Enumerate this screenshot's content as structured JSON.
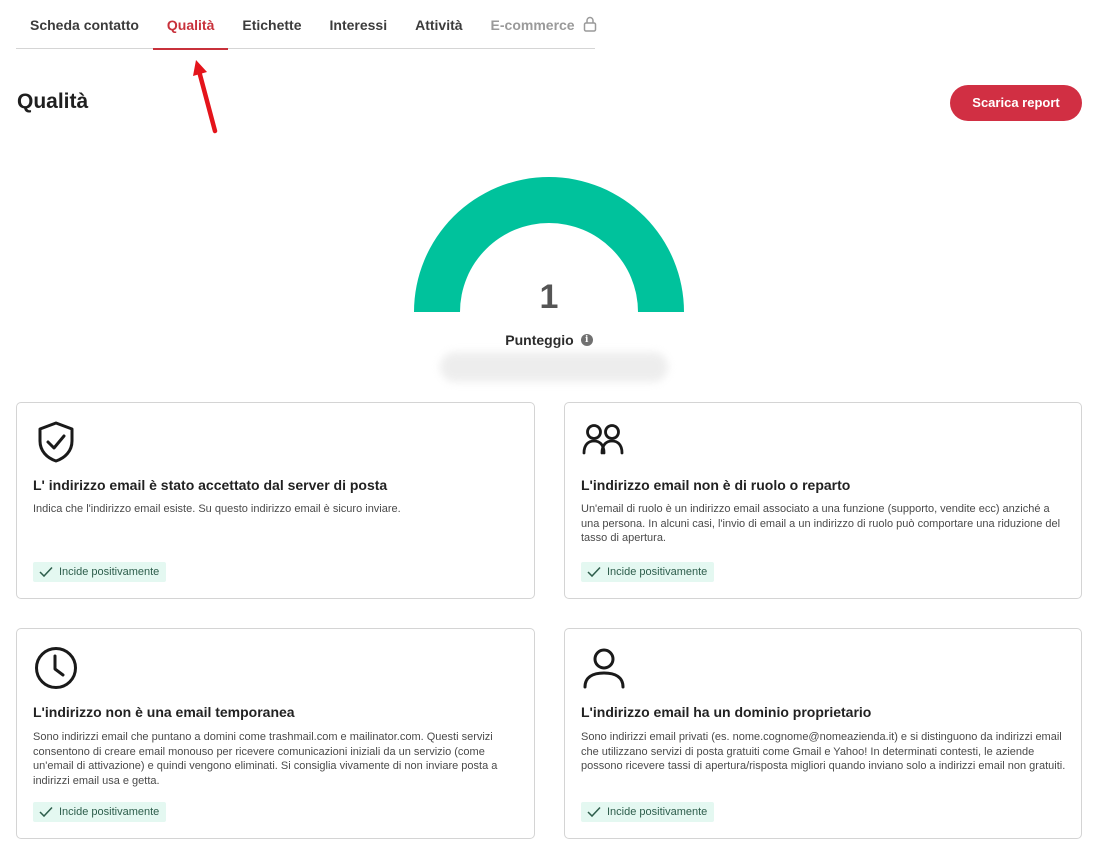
{
  "tabs": [
    {
      "label": "Scheda contatto"
    },
    {
      "label": "Qualità"
    },
    {
      "label": "Etichette"
    },
    {
      "label": "Interessi"
    },
    {
      "label": "Attività"
    },
    {
      "label": "E-commerce"
    }
  ],
  "header": {
    "title": "Qualità",
    "report_button": "Scarica report"
  },
  "gauge": {
    "value": "1",
    "label": "Punteggio",
    "color": "#00c29c"
  },
  "cards": [
    {
      "title": "L' indirizzo email è stato accettato dal server di posta",
      "text": "Indica che l'indirizzo email esiste. Su questo indirizzo email è sicuro inviare.",
      "badge": "Incide positivamente",
      "icon": "shield-check-icon"
    },
    {
      "title": "L'indirizzo email non è di ruolo o reparto",
      "text": "Un'email di ruolo è un indirizzo email associato a una funzione (supporto, vendite ecc) anziché a una persona. In alcuni casi, l'invio di email a un indirizzo di ruolo può comportare una riduzione del tasso di apertura.",
      "badge": "Incide positivamente",
      "icon": "users-icon"
    },
    {
      "title": "L'indirizzo non è una email temporanea",
      "text": "Sono indirizzi email che puntano a domini come trashmail.com e mailinator.com. Questi servizi consentono di creare email monouso per ricevere comunicazioni iniziali da un servizio (come un'email di attivazione) e quindi vengono eliminati. Si consiglia vivamente di non inviare posta a indirizzi email usa e getta.",
      "badge": "Incide positivamente",
      "icon": "clock-icon"
    },
    {
      "title": "L'indirizzo email ha un dominio proprietario",
      "text": "Sono indirizzi email privati (es. nome.cognome@nomeazienda.it) e si distinguono da indirizzi email che utilizzano servizi di posta gratuiti come Gmail e Yahoo! In determinati contesti, le aziende possono ricevere tassi di apertura/risposta migliori quando inviano solo a indirizzi email non gratuiti.",
      "badge": "Incide positivamente",
      "icon": "user-icon"
    }
  ],
  "colors": {
    "accent": "#c8313b",
    "button": "#d12f43",
    "badge_bg": "#e4f8f1"
  }
}
